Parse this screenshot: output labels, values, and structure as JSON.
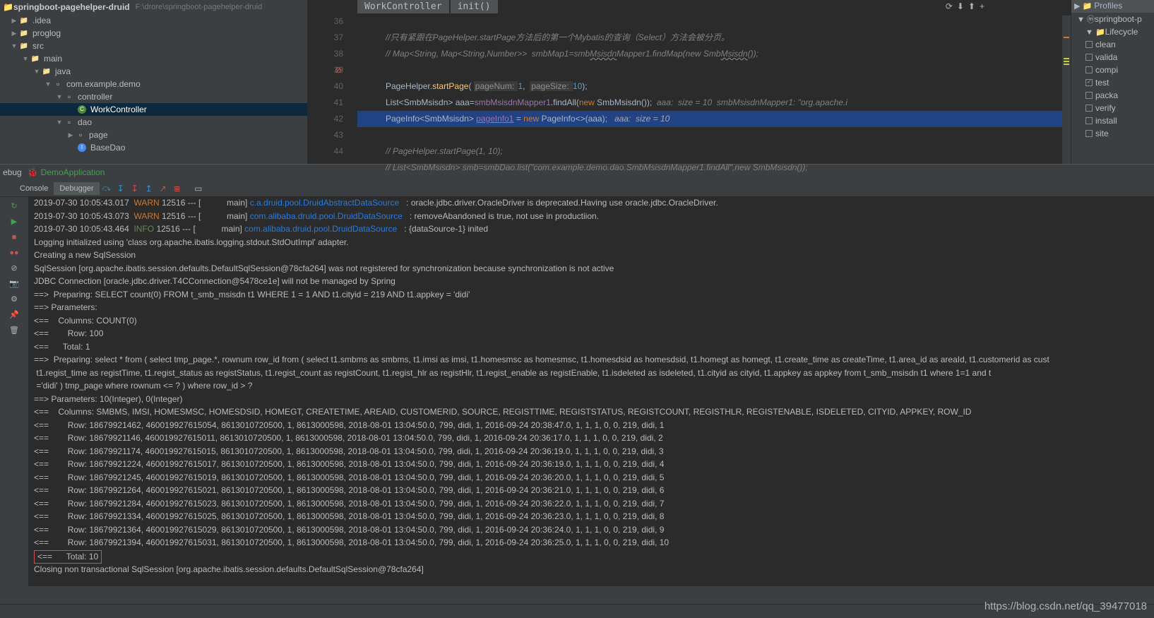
{
  "project": {
    "name": "springboot-pagehelper-druid",
    "path": "F:\\drore\\springboot-pagehelper-druid"
  },
  "tree": {
    "idea": ".idea",
    "proglog": "proglog",
    "src": "src",
    "main": "main",
    "java": "java",
    "pkg": "com.example.demo",
    "controller": "controller",
    "work": "WorkController",
    "dao": "dao",
    "page": "page",
    "basedao": "BaseDao"
  },
  "breadcrumb": {
    "cls": "WorkController",
    "method": "init()"
  },
  "code": {
    "l36": "            //只有紧跟在PageHelper.startPage方法后的第一个Mybatis的查询（Select）方法会被分页。",
    "l37a": "            // Map<String, Map<String,Number>>  smbMap1=smb",
    "l37b": "Msisdn",
    "l37c": "Mapper1.findMap(new Smb",
    "l37d": "Msisdn",
    "l37e": "());",
    "l39a": "            PageHelper.",
    "l39b": "startPage",
    "l39c": "( ",
    "l39p1": "pageNum: ",
    "l39n1": "1",
    "l39d": ",  ",
    "l39p2": "pageSize: ",
    "l39n2": "10",
    "l39e": ");",
    "l40a": "            List<SmbMsisdn> aaa=",
    "l40b": "smbMsisdnMapper1",
    "l40c": ".findAll(",
    "l40d": "new",
    "l40e": " SmbMsisdn());  ",
    "l40f": "aaa:  size = 10  smbMsisdnMapper1: \"org.apache.i",
    "l41a": "            PageInfo<SmbMsisdn> ",
    "l41b": "pageInfo1",
    "l41c": " = ",
    "l41d": "new",
    "l41e": " PageInfo<>(aaa);   ",
    "l41f": "aaa:  size = 10",
    "l43": "            // PageHelper.startPage(1, 10);",
    "l44": "            // List<SmbMsisdn> smb=smbDao.list(\"com.example.demo.dao.SmbMsisdnMapper1.findAll\",new SmbMsisdn());"
  },
  "lines": [
    "36",
    "37",
    "38",
    "39",
    "40",
    "41",
    "42",
    "43",
    "44"
  ],
  "maven": {
    "profiles": "Profiles",
    "root": "springboot-p",
    "lifecycle": "Lifecycle",
    "items": [
      "clean",
      "valida",
      "compi",
      "test",
      "packa",
      "verify",
      "install",
      "site"
    ]
  },
  "debug": {
    "label": "ebug",
    "app": "DemoApplication",
    "console": "Console",
    "debugger": "Debugger"
  },
  "log": {
    "l1a": "2019-07-30 10:05:43.017  ",
    "l1b": "WARN",
    "l1c": " 12516 --- [           main] ",
    "l1d": "c.a.druid.pool.DruidAbstractDataSource",
    "l1e": "   : oracle.jdbc.driver.OracleDriver is deprecated.Having use oracle.jdbc.OracleDriver.",
    "l2a": "2019-07-30 10:05:43.073  ",
    "l2b": "WARN",
    "l2c": " 12516 --- [           main] ",
    "l2d": "com.alibaba.druid.pool.DruidDataSource",
    "l2e": "   : removeAbandoned is true, not use in productiion.",
    "l3a": "2019-07-30 10:05:43.464  ",
    "l3b": "INFO",
    "l3c": " 12516 --- [           main] ",
    "l3d": "com.alibaba.druid.pool.DruidDataSource",
    "l3e": "   : {dataSource-1} inited",
    "l4": "Logging initialized using 'class org.apache.ibatis.logging.stdout.StdOutImpl' adapter.",
    "l5": "Creating a new SqlSession",
    "l6": "SqlSession [org.apache.ibatis.session.defaults.DefaultSqlSession@78cfa264] was not registered for synchronization because synchronization is not active",
    "l7": "JDBC Connection [oracle.jdbc.driver.T4CConnection@5478ce1e] will not be managed by Spring",
    "l8": "==>  Preparing: SELECT count(0) FROM t_smb_msisdn t1 WHERE 1 = 1 AND t1.cityid = 219 AND t1.appkey = 'didi' ",
    "l9": "==> Parameters: ",
    "l10": "<==    Columns: COUNT(0)",
    "l11": "<==        Row: 100",
    "l12": "<==      Total: 1",
    "l13": "==>  Preparing: select * from ( select tmp_page.*, rownum row_id from ( select t1.smbms as smbms, t1.imsi as imsi, t1.homesmsc as homesmsc, t1.homesdsid as homesdsid, t1.homegt as homegt, t1.create_time as createTime, t1.area_id as areaId, t1.customerid as cust",
    "l14": " t1.regist_time as registTime, t1.regist_status as registStatus, t1.regist_count as registCount, t1.regist_hlr as registHlr, t1.regist_enable as registEnable, t1.isdeleted as isdeleted, t1.cityid as cityid, t1.appkey as appkey from t_smb_msisdn t1 where 1=1 and t",
    "l15": " ='didi' ) tmp_page where rownum <= ? ) where row_id > ? ",
    "l16": "==> Parameters: 10(Integer), 0(Integer)",
    "l17": "<==    Columns: SMBMS, IMSI, HOMESMSC, HOMESDSID, HOMEGT, CREATETIME, AREAID, CUSTOMERID, SOURCE, REGISTTIME, REGISTSTATUS, REGISTCOUNT, REGISTHLR, REGISTENABLE, ISDELETED, CITYID, APPKEY, ROW_ID",
    "r1": "<==        Row: 18679921462, 460019927615054, 8613010720500, 1, 8613000598, 2018-08-01 13:04:50.0, 799, didi, 1, 2016-09-24 20:38:47.0, 1, 1, 1, 0, 0, 219, didi, 1",
    "r2": "<==        Row: 18679921146, 460019927615011, 8613010720500, 1, 8613000598, 2018-08-01 13:04:50.0, 799, didi, 1, 2016-09-24 20:36:17.0, 1, 1, 1, 0, 0, 219, didi, 2",
    "r3": "<==        Row: 18679921174, 460019927615015, 8613010720500, 1, 8613000598, 2018-08-01 13:04:50.0, 799, didi, 1, 2016-09-24 20:36:19.0, 1, 1, 1, 0, 0, 219, didi, 3",
    "r4": "<==        Row: 18679921224, 460019927615017, 8613010720500, 1, 8613000598, 2018-08-01 13:04:50.0, 799, didi, 1, 2016-09-24 20:36:19.0, 1, 1, 1, 0, 0, 219, didi, 4",
    "r5": "<==        Row: 18679921245, 460019927615019, 8613010720500, 1, 8613000598, 2018-08-01 13:04:50.0, 799, didi, 1, 2016-09-24 20:36:20.0, 1, 1, 1, 0, 0, 219, didi, 5",
    "r6": "<==        Row: 18679921264, 460019927615021, 8613010720500, 1, 8613000598, 2018-08-01 13:04:50.0, 799, didi, 1, 2016-09-24 20:36:21.0, 1, 1, 1, 0, 0, 219, didi, 6",
    "r7": "<==        Row: 18679921284, 460019927615023, 8613010720500, 1, 8613000598, 2018-08-01 13:04:50.0, 799, didi, 1, 2016-09-24 20:36:22.0, 1, 1, 1, 0, 0, 219, didi, 7",
    "r8": "<==        Row: 18679921334, 460019927615025, 8613010720500, 1, 8613000598, 2018-08-01 13:04:50.0, 799, didi, 1, 2016-09-24 20:36:23.0, 1, 1, 1, 0, 0, 219, didi, 8",
    "r9": "<==        Row: 18679921364, 460019927615029, 8613010720500, 1, 8613000598, 2018-08-01 13:04:50.0, 799, didi, 1, 2016-09-24 20:36:24.0, 1, 1, 1, 0, 0, 219, didi, 9",
    "r10": "<==        Row: 18679921394, 460019927615031, 8613010720500, 1, 8613000598, 2018-08-01 13:04:50.0, 799, didi, 1, 2016-09-24 20:36:25.0, 1, 1, 1, 0, 0, 219, didi, 10",
    "t": "<==      Total: 10",
    "close": "Closing non transactional SqlSession [org.apache.ibatis.session.defaults.DefaultSqlSession@78cfa264]"
  },
  "watermark": "https://blog.csdn.net/qq_39477018"
}
